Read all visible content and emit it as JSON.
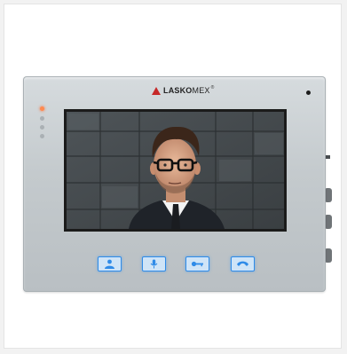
{
  "brand": {
    "name_bold": "LASKO",
    "name_light": "MEX",
    "reg_mark": "®"
  },
  "accent_color": "#2f8be8",
  "led_colors": [
    "#ff8a50",
    "#aab0b4",
    "#aab0b4",
    "#aab0b4"
  ],
  "controls": [
    {
      "icon": "user-icon",
      "name": "monitor-button"
    },
    {
      "icon": "microphone-icon",
      "name": "talk-button"
    },
    {
      "icon": "key-icon",
      "name": "unlock-button"
    },
    {
      "icon": "phone-handset-icon",
      "name": "hangup-button"
    }
  ]
}
